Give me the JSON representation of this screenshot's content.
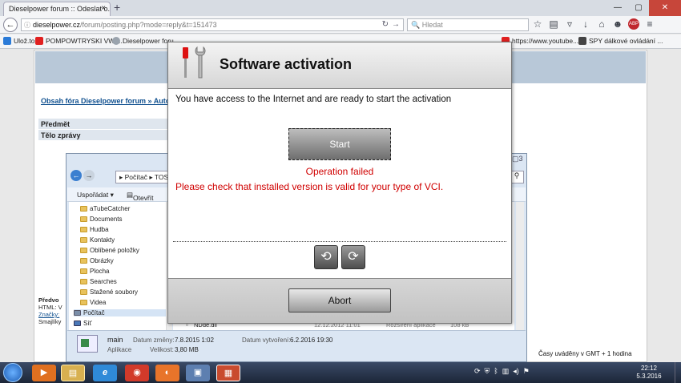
{
  "browser": {
    "tab_title": "Dieselpower forum :: Odeslat o...",
    "tab_close": "×",
    "new_tab": "+",
    "url_host": "dieselpower.cz",
    "url_path": "/forum/posting.php?mode=reply&t=151473",
    "search_placeholder": "Hledat",
    "window_controls": {
      "minimize": "—",
      "maximize": "▢",
      "close": "✕"
    },
    "bookmarks": [
      {
        "label": "Ulož.to",
        "color": "#2b7bd8"
      },
      {
        "label": "POMPOWTRYSKI VW ...",
        "color": "#e02020"
      },
      {
        "label": "Dieselpower foru",
        "color": "#9aa3ad"
      },
      {
        "label": "https://www.youtube....",
        "color": "#e02020"
      },
      {
        "label": "SPY dálkové ovládání ...",
        "color": "#444"
      }
    ],
    "nav_icons": [
      "star-icon",
      "reading-list-icon",
      "pocket-icon",
      "download-icon",
      "home-icon",
      "chat-icon",
      "adblock-icon",
      "menu-icon"
    ],
    "adblock_badge": "ABP"
  },
  "forum": {
    "breadcrumb": "Obsah fóra Dieselpower forum » Autodi",
    "subject_label": "Předmět",
    "body_label": "Tělo zprávy",
    "footer_lines": [
      "Předvo",
      "HTML: V",
      "Značky:",
      "Smajlíky"
    ],
    "timezone": "Časy uváděny v GMT + 1 hodina"
  },
  "explorer": {
    "path_root": "Počítač",
    "path_next": "TOSH",
    "organize": "Uspořádat ▾",
    "open": "Otevřít",
    "tree": [
      "aTubeCatcher",
      "Documents",
      "Hudba",
      "Kontakty",
      "Oblíbené položky",
      "Obrázky",
      "Plocha",
      "Searches",
      "Stažené soubory",
      "Videa",
      "Počítač",
      "Síť"
    ],
    "file_row": {
      "name": "NDde.dll",
      "date": "12.12.2012 11:01",
      "type": "Rozšíření aplikace",
      "size": "108 kB"
    },
    "details": {
      "name": "main",
      "modified_label": "Datum změny:",
      "modified_value": "7.8.2015 1:02",
      "created_label": "Datum vytvoření:",
      "created_value": "6.2.2016 19:30",
      "type_value": "Aplikace",
      "size_label": "Velikost:",
      "size_value": "3,80 MB"
    }
  },
  "dialog": {
    "title": "Software activation",
    "message": "You have access to the Internet and are ready to start the activation",
    "start_label": "Start",
    "error_title": "Operation failed",
    "error_detail": "Please check that installed version is valid for your type of VCI.",
    "prev_symbol": "⟲",
    "next_symbol": "⟳",
    "abort_label": "Abort"
  },
  "taskbar": {
    "time": "22:12",
    "date": "5.3.2016",
    "apps": [
      {
        "icon": "media-player-icon",
        "glyph": "▶",
        "color": "#e07020"
      },
      {
        "icon": "file-explorer-icon",
        "glyph": "▤",
        "color": "#d8b050"
      },
      {
        "icon": "internet-explorer-icon",
        "glyph": "e",
        "color": "#2f8ad8"
      },
      {
        "icon": "chrome-icon",
        "glyph": "◉",
        "color": "#d23a2a"
      },
      {
        "icon": "firefox-icon",
        "glyph": "◐",
        "color": "#e8742a"
      },
      {
        "icon": "remote-desktop-icon",
        "glyph": "▣",
        "color": "#5d7fb0"
      },
      {
        "icon": "activation-app-icon",
        "glyph": "▦",
        "color": "#c94b2e"
      }
    ],
    "tray_icons": [
      "update-icon",
      "security-icon",
      "bluetooth-icon",
      "network-icon",
      "volume-icon",
      "flag-icon"
    ]
  }
}
